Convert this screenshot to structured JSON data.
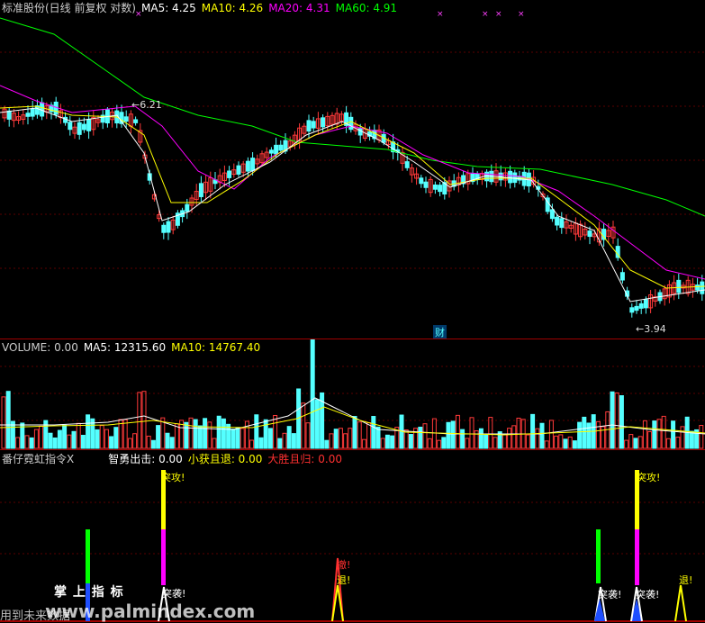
{
  "main_header": {
    "title": "标准股份(日线 前复权 对数)",
    "ma5": "MA5: 4.25",
    "ma10": "MA10: 4.26",
    "ma20": "MA20: 4.31",
    "ma60": "MA60: 4.91"
  },
  "main_annotations": {
    "high": "6.21",
    "low": "3.94",
    "finance_mark": "财"
  },
  "volume_header": {
    "volume": "VOLUME: 0.00",
    "ma5": "MA5: 12315.60",
    "ma10": "MA10: 14767.40"
  },
  "indicator_header": {
    "name": "番仔霓虹指令X",
    "zhiyong": "智勇出击: 0.00",
    "xiaohuo": "小获且退: 0.00",
    "dasheng": "大胜且归: 0.00"
  },
  "indicator_labels": {
    "attack": "突攻!",
    "raid": "突袭!",
    "retreat": "退!",
    "withdraw": "撤!"
  },
  "watermark": {
    "brand": "掌 上 指 标",
    "site": "www.palmindex.com",
    "footer": "用到未来数据"
  },
  "colors": {
    "background": "#000000",
    "separator": "#a00000",
    "up": "#ff3a3a",
    "down": "#54ffff",
    "ma5": "#ffffff",
    "ma10": "#ffff00",
    "ma20": "#ff00ff",
    "ma60": "#00ff00",
    "red_text": "#ff3030"
  },
  "chart_data": [
    {
      "type": "candlestick",
      "title": "标准股份(日线 前复权 对数)",
      "price_high_label": 6.21,
      "price_low_label": 3.94,
      "last_ma": {
        "MA5": 4.25,
        "MA10": 4.26,
        "MA20": 4.31,
        "MA60": 4.91
      }
    },
    {
      "type": "bar",
      "title": "VOLUME",
      "last_values": {
        "VOLUME": 0.0,
        "MA5": 12315.6,
        "MA10": 14767.4
      }
    },
    {
      "type": "bar",
      "title": "番仔霓虹指令X",
      "last_values": {
        "智勇出击": 0.0,
        "小获且退": 0.0,
        "大胜且归": 0.0
      }
    }
  ]
}
